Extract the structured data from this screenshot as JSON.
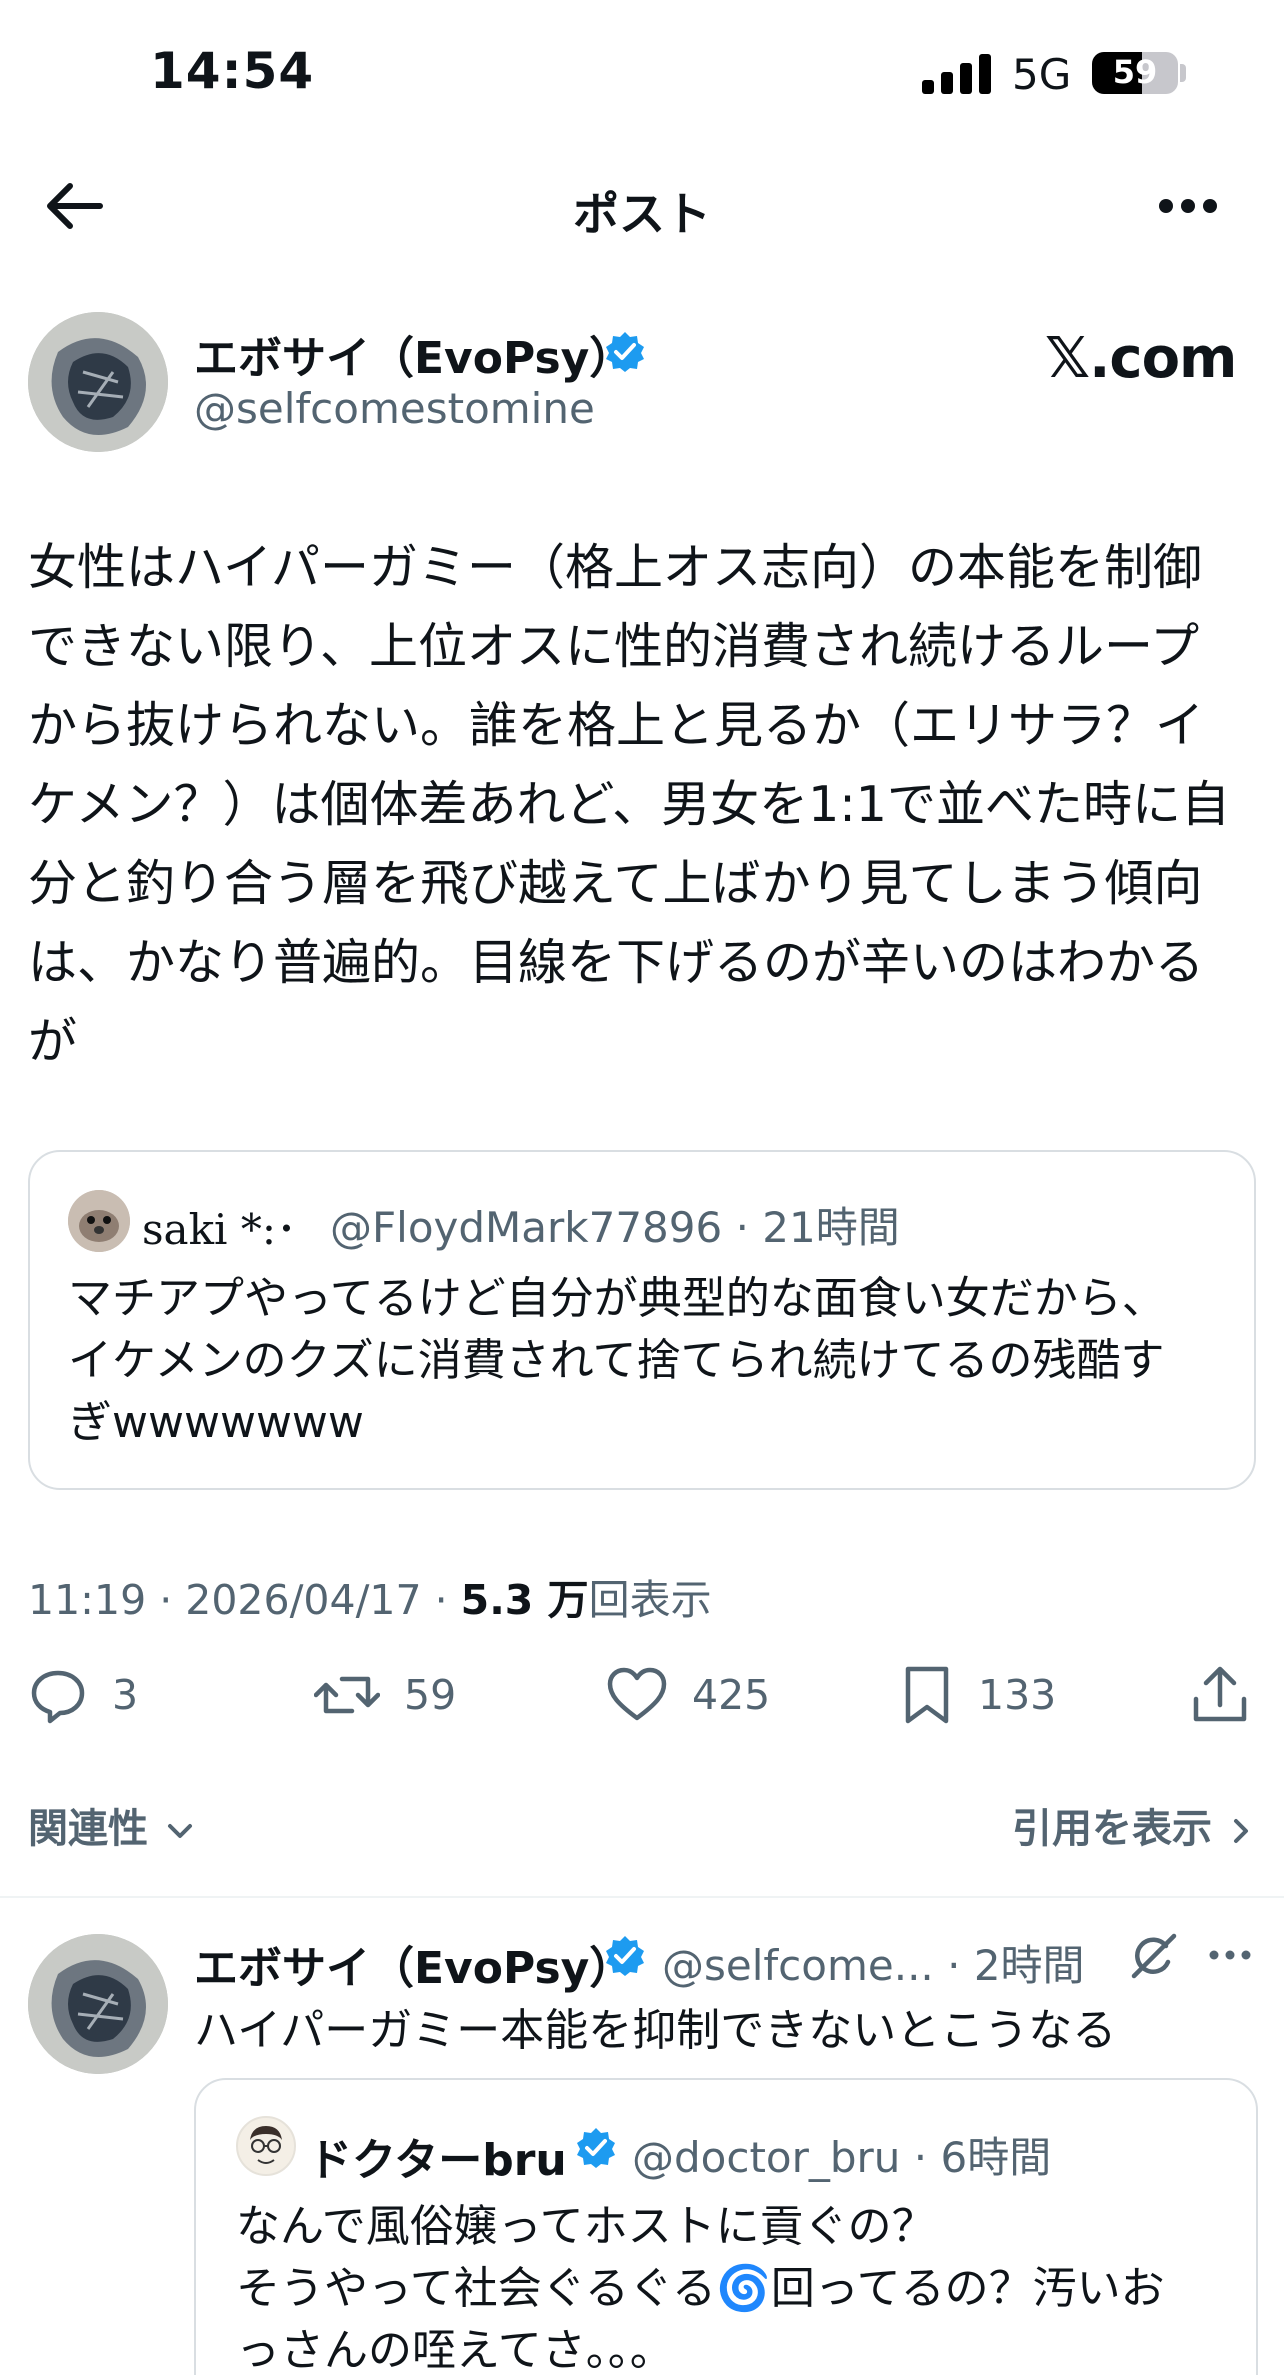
{
  "status_bar": {
    "time": "14:54",
    "network": "5G",
    "battery": "59"
  },
  "nav": {
    "title": "ポスト",
    "back_icon": "arrow-left-icon",
    "more_icon": "more-horizontal-icon"
  },
  "post": {
    "author": {
      "name": "エボサイ（EvoPsy）",
      "handle": "@selfcomestomine",
      "verified": true
    },
    "watermark": "𝕏.com",
    "body": "女性はハイパーガミー（格上オス志向）の本能を制御\nできない限り、上位オスに性的消費され続けるループ\nから抜けられない。誰を格上と見るか（エリサラ？イ\nケメン？）は個体差あれど、男女を1:1で並べた時に自\n分と釣り合う層を飛び越えて上ばかり見てしまう傾向\nは、かなり普遍的。目線を下げるのが辛いのはわかる\nが",
    "quote": {
      "name": "saki *:･",
      "handle": "@FloydMark77896 · 21時間",
      "body": "マチアプやってるけど自分が典型的な面食い女だから、\nイケメンのクズに消費されて捨てられ続けてるの残酷す\nぎwwwwwww"
    },
    "meta": {
      "time_date": "11:19 · 2026/04/17 · ",
      "views_count": "5.3 万",
      "views_label": "回表示"
    },
    "actions": {
      "replies": "3",
      "reposts": "59",
      "likes": "425",
      "bookmarks": "133"
    }
  },
  "related": {
    "label": "関連性",
    "quotes_label": "引用を表示"
  },
  "reply": {
    "author": {
      "name": "エボサイ（EvoPsy）",
      "handle": "@selfcome... · 2時間",
      "verified": true
    },
    "text": "ハイパーガミー本能を抑制できないとこうなる",
    "quote": {
      "name": "ドクターbru",
      "handle": "@doctor_bru · 6時間",
      "body": "なんで風俗嬢ってホストに貢ぐの？\nそうやって社会ぐるぐる🌀回ってるの？汚いお\nっさんの咥えてさ。。。"
    }
  },
  "colors": {
    "text": "#0f1419",
    "secondary": "#536471",
    "verified": "#1d9bf0",
    "border": "#d9dee2"
  }
}
